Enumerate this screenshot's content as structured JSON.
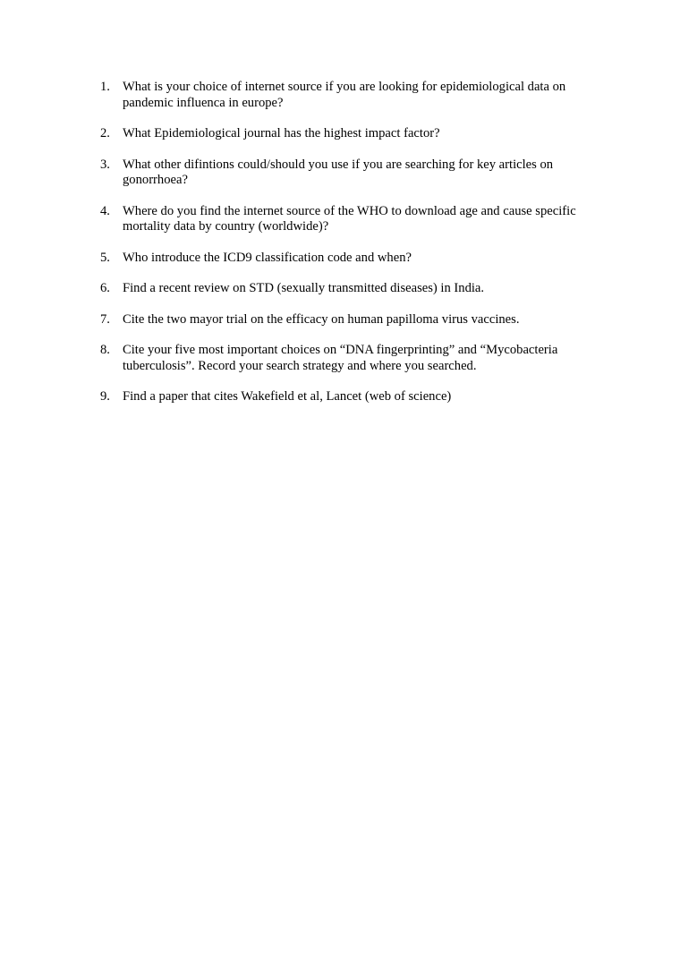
{
  "document": {
    "questions": [
      {
        "number": "1.",
        "text": "What is your choice of internet source if you are looking for epidemiological data on pandemic influenca in europe?"
      },
      {
        "number": "2.",
        "text": "What Epidemiological journal has the highest impact factor?"
      },
      {
        "number": "3.",
        "text": "What other difintions could/should you use if you are searching for key articles on gonorrhoea?"
      },
      {
        "number": "4.",
        "text": "Where do you find the internet source of the WHO to download age and cause specific mortality data by country (worldwide)?"
      },
      {
        "number": "5.",
        "text": "Who introduce the ICD9 classification code and when?"
      },
      {
        "number": "6.",
        "text": "Find a recent review on STD (sexually transmitted diseases) in India."
      },
      {
        "number": "7.",
        "text": "Cite the two mayor trial on the efficacy on human papilloma virus vaccines."
      },
      {
        "number": "8.",
        "text": "Cite your five most important choices on “DNA fingerprinting” and “Mycobacteria tuberculosis”. Record your search strategy and where you searched."
      },
      {
        "number": "9.",
        "text": "Find a paper that cites Wakefield et al, Lancet (web of science)"
      }
    ]
  }
}
